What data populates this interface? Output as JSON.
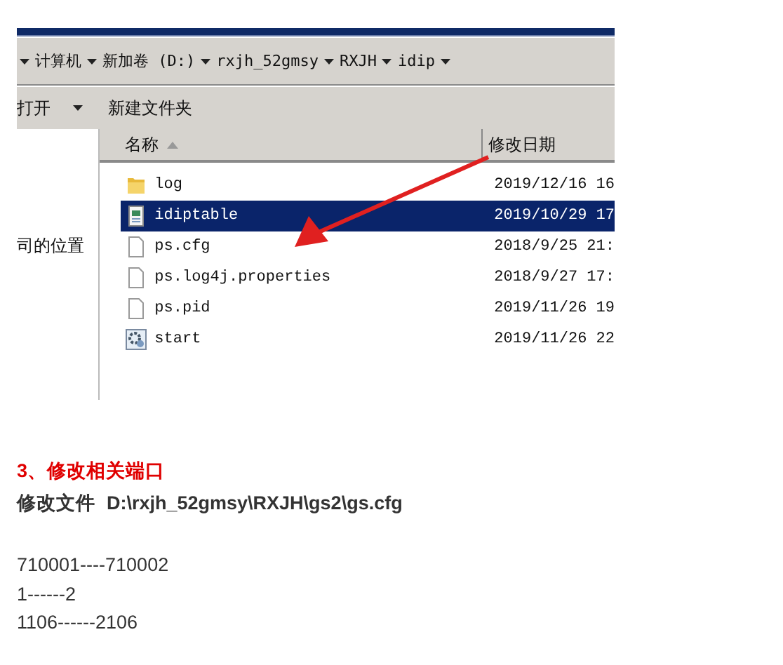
{
  "breadcrumb": [
    "计算机",
    "新加卷 (D:)",
    "rxjh_52gmsy",
    "RXJH",
    "idip"
  ],
  "toolbar": [
    {
      "label": "打开",
      "dropdown": true
    },
    {
      "label": "新建文件夹",
      "dropdown": false
    }
  ],
  "nav_pane": {
    "items": [
      "司的位置"
    ]
  },
  "file_list": {
    "columns": [
      {
        "label": "名称",
        "sorted": true
      },
      {
        "label": "修改日期",
        "sorted": false
      }
    ],
    "rows": [
      {
        "name": "log",
        "kind": "folder",
        "modified": "2019/12/16 16",
        "selected": false
      },
      {
        "name": "idiptable",
        "kind": "table",
        "modified": "2019/10/29 17",
        "selected": true
      },
      {
        "name": "ps.cfg",
        "kind": "blank",
        "modified": "2018/9/25 21:",
        "selected": false
      },
      {
        "name": "ps.log4j.properties",
        "kind": "blank",
        "modified": "2018/9/27 17:",
        "selected": false
      },
      {
        "name": "ps.pid",
        "kind": "blank",
        "modified": "2019/11/26 19",
        "selected": false
      },
      {
        "name": "start",
        "kind": "script",
        "modified": "2019/11/26 22",
        "selected": false
      }
    ]
  },
  "article": {
    "heading": "3、修改相关端口",
    "file_label": "修改文件",
    "file_path": "D:\\rxjh_52gmsy\\RXJH\\gs2\\gs.cfg",
    "lines": [
      "710001----710002",
      "1------2",
      "1106------2106"
    ]
  }
}
